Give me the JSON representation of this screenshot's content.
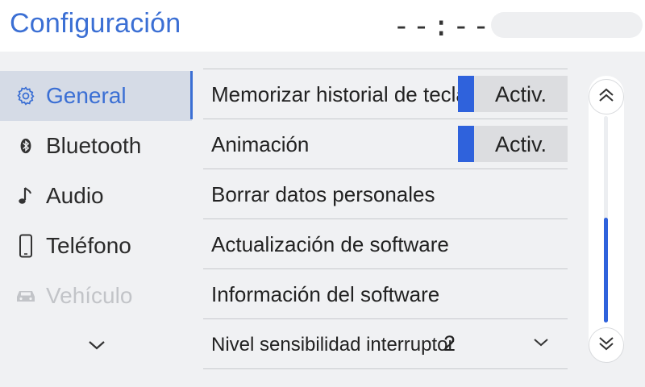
{
  "header": {
    "title": "Configuración",
    "clock": "--:--"
  },
  "sidebar": {
    "items": [
      {
        "label": "General",
        "icon": "gear-icon",
        "active": true
      },
      {
        "label": "Bluetooth",
        "icon": "bluetooth-icon"
      },
      {
        "label": "Audio",
        "icon": "music-note-icon"
      },
      {
        "label": "Teléfono",
        "icon": "phone-icon"
      },
      {
        "label": "Vehículo",
        "icon": "car-icon",
        "disabled": true
      }
    ],
    "more_icon": "chevron-down-icon"
  },
  "settings": {
    "rows": [
      {
        "label": "Memorizar historial de teclado",
        "toggle": "Activ."
      },
      {
        "label": "Animación",
        "toggle": "Activ."
      },
      {
        "label": "Borrar datos personales"
      },
      {
        "label": "Actualización de software"
      },
      {
        "label": "Información del software"
      },
      {
        "label": "Nivel sensibilidad interruptor",
        "value": "2"
      }
    ]
  },
  "scrollbar": {
    "up_icon": "double-chevron-up-icon",
    "down_icon": "double-chevron-down-icon"
  },
  "colors": {
    "accent": "#3b6fd4",
    "toggle_on": "#2f62dc",
    "active_bg": "#d5dbe6"
  }
}
